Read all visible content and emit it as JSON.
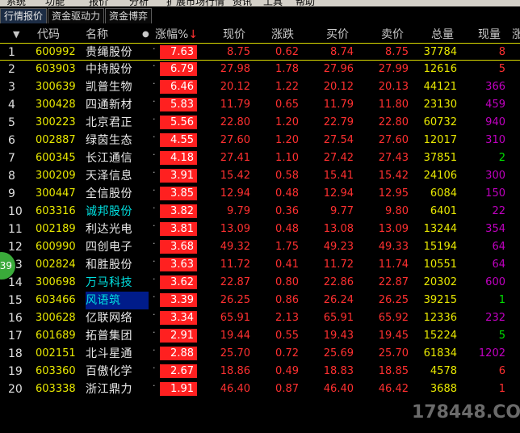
{
  "menu": [
    "系统",
    "功能",
    "报价",
    "分析",
    "扩展市场行情",
    "资讯",
    "工具",
    "帮助"
  ],
  "tabs": [
    "行情报价",
    "资金驱动力",
    "资金博弈"
  ],
  "columns": {
    "code": "代码",
    "name": "名称",
    "pct": "涨幅%",
    "price": "现价",
    "chg": "涨跌",
    "buy": "买价",
    "sell": "卖价",
    "vol": "总量",
    "cur": "现量",
    "extra": "涨"
  },
  "rows": [
    {
      "n": "1",
      "code": "600992",
      "name": "贵绳股份",
      "pct": "7.63",
      "price": "8.75",
      "chg": "0.62",
      "buy": "8.74",
      "sell": "8.75",
      "vol": "37784",
      "cur": "8",
      "cur_color": "#ff3030"
    },
    {
      "n": "2",
      "code": "603903",
      "name": "中持股份",
      "pct": "6.79",
      "price": "27.98",
      "chg": "1.78",
      "buy": "27.96",
      "sell": "27.99",
      "vol": "12616",
      "cur": "5",
      "cur_color": "#ff3030"
    },
    {
      "n": "3",
      "code": "300639",
      "name": "凯普生物",
      "pct": "6.46",
      "price": "20.12",
      "chg": "1.22",
      "buy": "20.12",
      "sell": "20.13",
      "vol": "44121",
      "cur": "366",
      "cur_color": "#c000c0"
    },
    {
      "n": "4",
      "code": "300428",
      "name": "四通新材",
      "pct": "5.83",
      "price": "11.79",
      "chg": "0.65",
      "buy": "11.79",
      "sell": "11.80",
      "vol": "23130",
      "cur": "459",
      "cur_color": "#c000c0"
    },
    {
      "n": "5",
      "code": "300223",
      "name": "北京君正",
      "pct": "5.56",
      "price": "22.80",
      "chg": "1.20",
      "buy": "22.79",
      "sell": "22.80",
      "vol": "60732",
      "cur": "940",
      "cur_color": "#c000c0"
    },
    {
      "n": "6",
      "code": "002887",
      "name": "绿茵生态",
      "pct": "4.55",
      "price": "27.60",
      "chg": "1.20",
      "buy": "27.54",
      "sell": "27.60",
      "vol": "12017",
      "cur": "310",
      "cur_color": "#c000c0"
    },
    {
      "n": "7",
      "code": "600345",
      "name": "长江通信",
      "pct": "4.18",
      "price": "27.41",
      "chg": "1.10",
      "buy": "27.42",
      "sell": "27.43",
      "vol": "37851",
      "cur": "2",
      "cur_color": "#00e000"
    },
    {
      "n": "8",
      "code": "300209",
      "name": "天泽信息",
      "pct": "3.91",
      "price": "15.42",
      "chg": "0.58",
      "buy": "15.41",
      "sell": "15.42",
      "vol": "24106",
      "cur": "300",
      "cur_color": "#c000c0"
    },
    {
      "n": "9",
      "code": "300447",
      "name": "全信股份",
      "pct": "3.85",
      "price": "12.94",
      "chg": "0.48",
      "buy": "12.94",
      "sell": "12.95",
      "vol": "6084",
      "cur": "150",
      "cur_color": "#c000c0"
    },
    {
      "n": "10",
      "code": "603316",
      "name": "诚邦股份",
      "pct": "3.82",
      "price": "9.79",
      "chg": "0.36",
      "buy": "9.77",
      "sell": "9.80",
      "vol": "6401",
      "cur": "22",
      "cur_color": "#c000c0",
      "name_color": "cyan"
    },
    {
      "n": "11",
      "code": "002189",
      "name": "利达光电",
      "pct": "3.81",
      "price": "13.09",
      "chg": "0.48",
      "buy": "13.08",
      "sell": "13.09",
      "vol": "13244",
      "cur": "354",
      "cur_color": "#c000c0"
    },
    {
      "n": "12",
      "code": "600990",
      "name": "四创电子",
      "pct": "3.68",
      "price": "49.32",
      "chg": "1.75",
      "buy": "49.23",
      "sell": "49.33",
      "vol": "15194",
      "cur": "64",
      "cur_color": "#c000c0"
    },
    {
      "n": "13",
      "code": "002824",
      "name": "和胜股份",
      "pct": "3.63",
      "price": "11.72",
      "chg": "0.41",
      "buy": "11.72",
      "sell": "11.74",
      "vol": "10551",
      "cur": "64",
      "cur_color": "#c000c0"
    },
    {
      "n": "14",
      "code": "300698",
      "name": "万马科技",
      "pct": "3.62",
      "price": "22.87",
      "chg": "0.80",
      "buy": "22.86",
      "sell": "22.87",
      "vol": "20302",
      "cur": "600",
      "cur_color": "#c000c0",
      "name_color": "cyan"
    },
    {
      "n": "15",
      "code": "603466",
      "name": "风语筑",
      "pct": "3.39",
      "price": "26.25",
      "chg": "0.86",
      "buy": "26.24",
      "sell": "26.25",
      "vol": "39215",
      "cur": "1",
      "cur_color": "#00e000",
      "name_color": "cyan",
      "name_hl": true
    },
    {
      "n": "16",
      "code": "300628",
      "name": "亿联网络",
      "pct": "3.34",
      "price": "65.91",
      "chg": "2.13",
      "buy": "65.91",
      "sell": "65.92",
      "vol": "12336",
      "cur": "232",
      "cur_color": "#c000c0"
    },
    {
      "n": "17",
      "code": "601689",
      "name": "拓普集团",
      "pct": "2.91",
      "price": "19.44",
      "chg": "0.55",
      "buy": "19.43",
      "sell": "19.45",
      "vol": "15224",
      "cur": "5",
      "cur_color": "#00e000"
    },
    {
      "n": "18",
      "code": "002151",
      "name": "北斗星通",
      "pct": "2.88",
      "price": "25.70",
      "chg": "0.72",
      "buy": "25.69",
      "sell": "25.70",
      "vol": "61834",
      "cur": "1202",
      "cur_color": "#c000c0"
    },
    {
      "n": "19",
      "code": "603360",
      "name": "百傲化学",
      "pct": "2.67",
      "price": "18.86",
      "chg": "0.49",
      "buy": "18.83",
      "sell": "18.85",
      "vol": "4578",
      "cur": "6",
      "cur_color": "#ff3030"
    },
    {
      "n": "20",
      "code": "603338",
      "name": "浙江鼎力",
      "pct": "1.91",
      "price": "46.40",
      "chg": "0.87",
      "buy": "46.40",
      "sell": "46.42",
      "vol": "3688",
      "cur": "1",
      "cur_color": "#ff3030"
    }
  ],
  "float_badge": "39",
  "watermark": "178448.COM",
  "colors": {
    "up": "#ff3030",
    "code": "#e8e800",
    "pct_bg": "#ff2020"
  }
}
